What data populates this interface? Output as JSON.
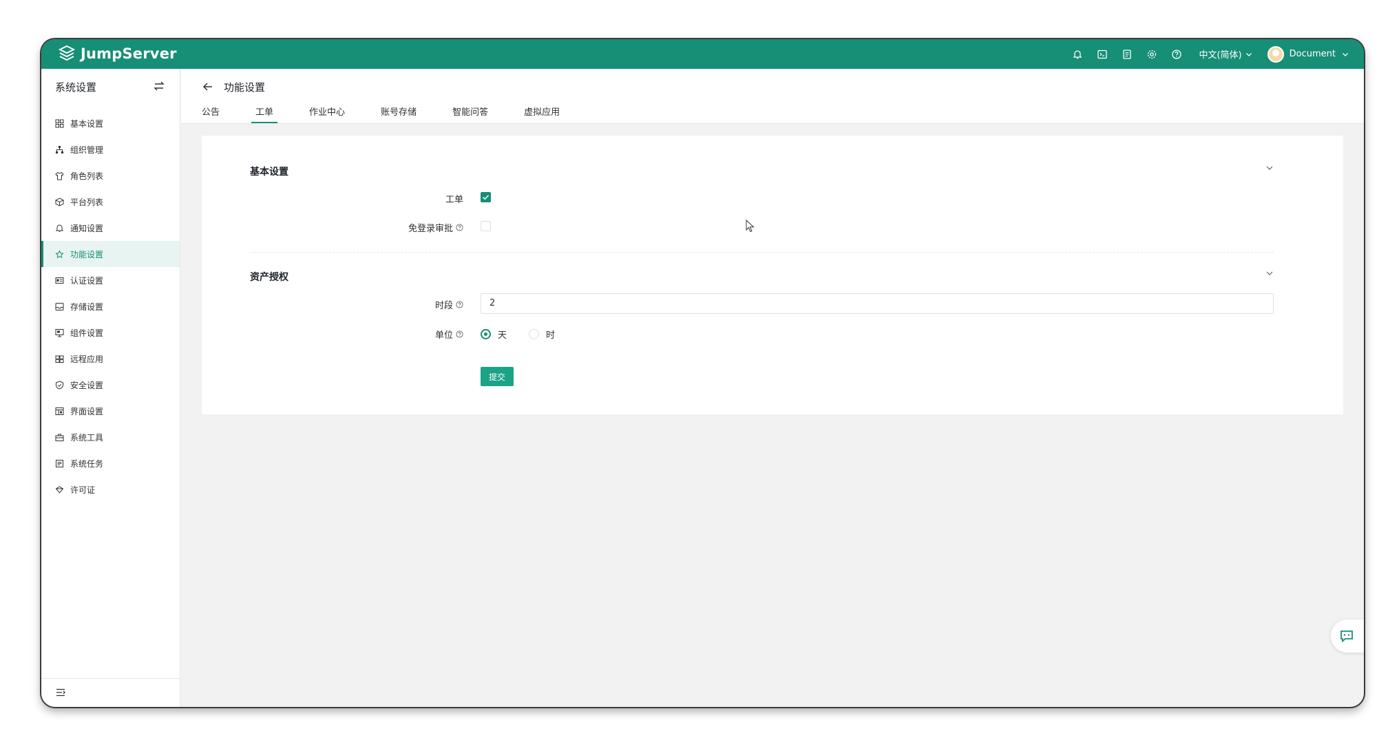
{
  "app": {
    "logo_text": "JumpServer"
  },
  "topbar": {
    "language": "中文(简体)",
    "user": "Document"
  },
  "sidebar": {
    "title": "系统设置",
    "items": [
      {
        "label": "基本设置",
        "icon": "grid-icon"
      },
      {
        "label": "组织管理",
        "icon": "org-tree-icon"
      },
      {
        "label": "角色列表",
        "icon": "shirt-icon"
      },
      {
        "label": "平台列表",
        "icon": "cube-icon"
      },
      {
        "label": "通知设置",
        "icon": "bell-icon"
      },
      {
        "label": "功能设置",
        "icon": "feature-icon"
      },
      {
        "label": "认证设置",
        "icon": "id-card-icon"
      },
      {
        "label": "存储设置",
        "icon": "storage-icon"
      },
      {
        "label": "组件设置",
        "icon": "monitor-icon"
      },
      {
        "label": "远程应用",
        "icon": "apps-icon"
      },
      {
        "label": "安全设置",
        "icon": "shield-icon"
      },
      {
        "label": "界面设置",
        "icon": "layout-icon"
      },
      {
        "label": "系统工具",
        "icon": "toolbox-icon"
      },
      {
        "label": "系统任务",
        "icon": "task-icon"
      },
      {
        "label": "许可证",
        "icon": "license-icon"
      }
    ],
    "active_index": 5
  },
  "page": {
    "title": "功能设置",
    "tabs": [
      {
        "label": "公告"
      },
      {
        "label": "工单"
      },
      {
        "label": "作业中心"
      },
      {
        "label": "账号存储"
      },
      {
        "label": "智能问答"
      },
      {
        "label": "虚拟应用"
      }
    ],
    "active_tab": 1
  },
  "form": {
    "section1": {
      "title": "基本设置",
      "ticket_label": "工单",
      "ticket_checked": true,
      "login_approval_label": "免登录审批",
      "login_approval_checked": false
    },
    "section2": {
      "title": "资产授权",
      "period_label": "时段",
      "period_value": "2",
      "unit_label": "单位",
      "unit_options": [
        "天",
        "时"
      ],
      "unit_selected": "天"
    },
    "submit_label": "提交"
  }
}
